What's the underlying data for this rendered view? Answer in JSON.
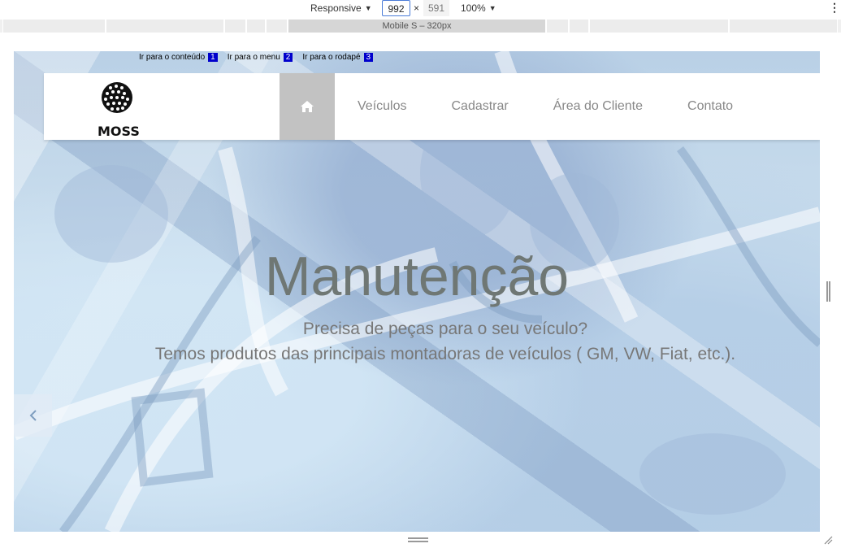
{
  "devtools": {
    "device": "Responsive",
    "width": "992",
    "times": "×",
    "height": "591",
    "zoom": "100%",
    "media_query_label": "Mobile S – 320px"
  },
  "skip_links": [
    {
      "label": "Ir para o conteúdo",
      "num": "1"
    },
    {
      "label": "Ir para o menu",
      "num": "2"
    },
    {
      "label": "Ir para o rodapé",
      "num": "3"
    }
  ],
  "logo": {
    "text": "MOSS"
  },
  "nav": {
    "items": [
      "Veículos",
      "Cadastrar",
      "Área do Cliente",
      "Contato"
    ]
  },
  "hero": {
    "title": "Manutenção",
    "line1": "Precisa de peças para o seu veículo?",
    "line2": "Temos produtos das principais montadoras de veículos ( GM, VW, Fiat, etc.)."
  }
}
